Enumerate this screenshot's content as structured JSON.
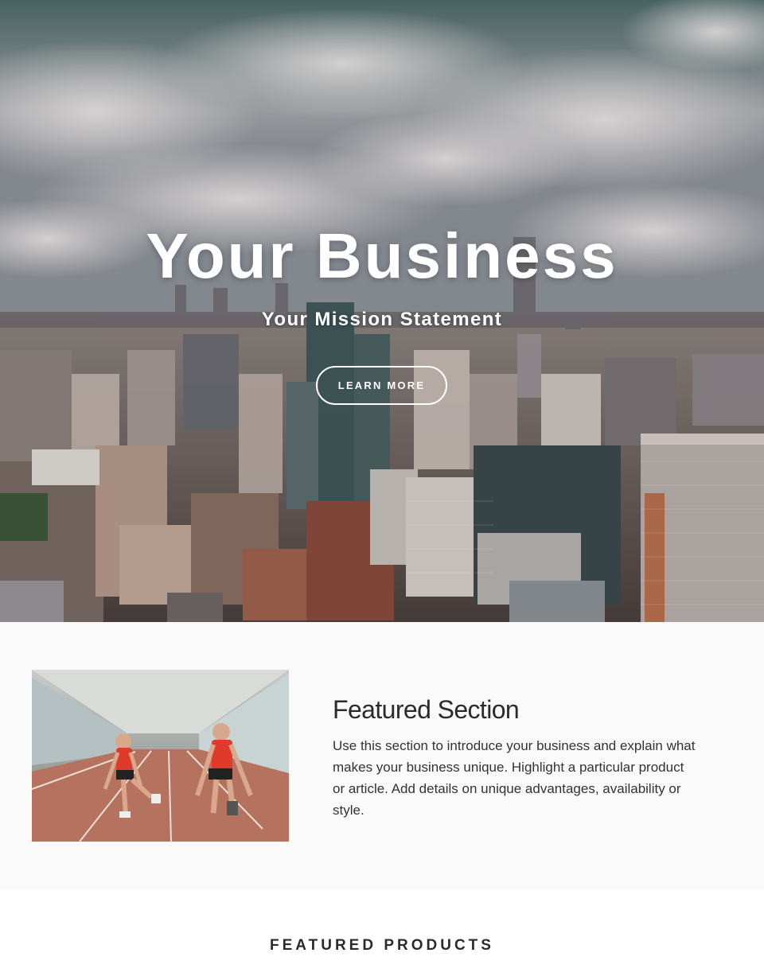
{
  "hero": {
    "title": "Your Business",
    "subtitle": "Your Mission Statement",
    "cta_label": "LEARN MORE"
  },
  "featured_section": {
    "title": "Featured Section",
    "body": "Use this section to introduce your business and explain what makes your business unique. Highlight a particular product or article. Add details on unique advantages, availability or style."
  },
  "featured_products": {
    "title": "FEATURED PRODUCTS"
  },
  "colors": {
    "text_dark": "#2b2b2b",
    "section_bg": "#fafafa",
    "hero_text": "#ffffff"
  }
}
